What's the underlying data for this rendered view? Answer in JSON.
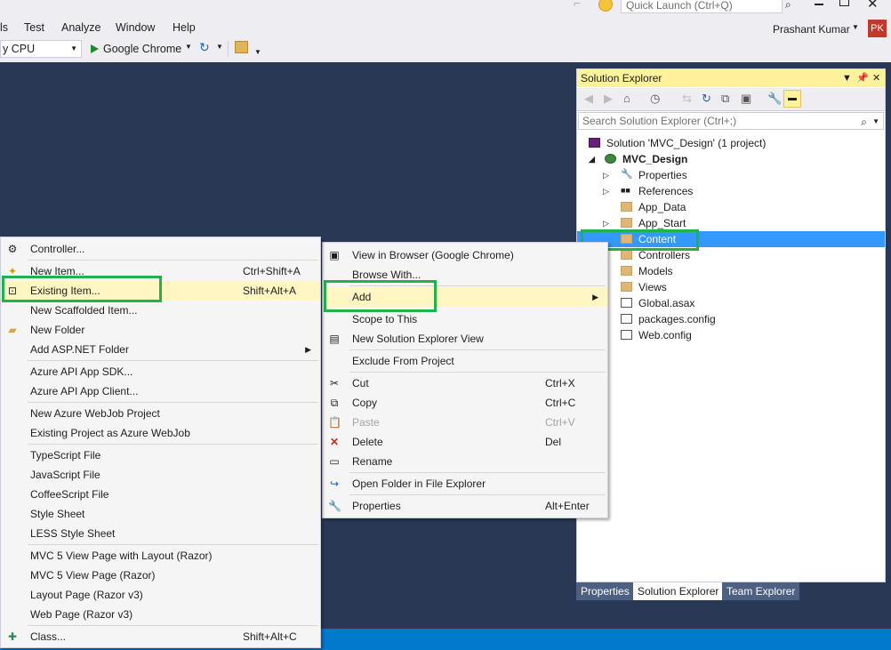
{
  "menubar": {
    "items": [
      "ls",
      "Test",
      "Analyze",
      "Window",
      "Help"
    ]
  },
  "quick_launch": {
    "placeholder": "Quick Launch (Ctrl+Q)"
  },
  "user": {
    "name": "Prashant Kumar",
    "initials": "PK"
  },
  "toolbar": {
    "platform": "y CPU",
    "run_target": "Google Chrome"
  },
  "add_menu": {
    "items": [
      {
        "label": "Controller...",
        "shortcut": ""
      },
      {
        "label": "New Item...",
        "shortcut": "Ctrl+Shift+A"
      },
      {
        "label": "Existing Item...",
        "shortcut": "Shift+Alt+A"
      },
      {
        "label": "New Scaffolded Item...",
        "shortcut": ""
      },
      {
        "label": "New Folder",
        "shortcut": ""
      },
      {
        "label": "Add ASP.NET Folder",
        "shortcut": ""
      },
      {
        "label": "Azure API App SDK...",
        "shortcut": ""
      },
      {
        "label": "Azure API App Client...",
        "shortcut": ""
      },
      {
        "label": "New Azure WebJob Project",
        "shortcut": ""
      },
      {
        "label": "Existing Project as Azure WebJob",
        "shortcut": ""
      },
      {
        "label": "TypeScript File",
        "shortcut": ""
      },
      {
        "label": "JavaScript File",
        "shortcut": ""
      },
      {
        "label": "CoffeeScript File",
        "shortcut": ""
      },
      {
        "label": "Style Sheet",
        "shortcut": ""
      },
      {
        "label": "LESS Style Sheet",
        "shortcut": ""
      },
      {
        "label": "MVC 5 View Page with Layout (Razor)",
        "shortcut": ""
      },
      {
        "label": "MVC 5 View Page (Razor)",
        "shortcut": ""
      },
      {
        "label": "Layout Page (Razor v3)",
        "shortcut": ""
      },
      {
        "label": "Web Page (Razor v3)",
        "shortcut": ""
      },
      {
        "label": "Class...",
        "shortcut": "Shift+Alt+C"
      }
    ]
  },
  "project_menu": {
    "items": [
      {
        "label": "View in Browser (Google Chrome)",
        "shortcut": ""
      },
      {
        "label": "Browse With...",
        "shortcut": ""
      },
      {
        "label": "Add",
        "shortcut": ""
      },
      {
        "label": "Scope to This",
        "shortcut": ""
      },
      {
        "label": "New Solution Explorer View",
        "shortcut": ""
      },
      {
        "label": "Exclude From Project",
        "shortcut": ""
      },
      {
        "label": "Cut",
        "shortcut": "Ctrl+X"
      },
      {
        "label": "Copy",
        "shortcut": "Ctrl+C"
      },
      {
        "label": "Paste",
        "shortcut": "Ctrl+V"
      },
      {
        "label": "Delete",
        "shortcut": "Del"
      },
      {
        "label": "Rename",
        "shortcut": ""
      },
      {
        "label": "Open Folder in File Explorer",
        "shortcut": ""
      },
      {
        "label": "Properties",
        "shortcut": "Alt+Enter"
      }
    ]
  },
  "solution_explorer": {
    "title": "Solution Explorer",
    "search_placeholder": "Search Solution Explorer (Ctrl+;)",
    "tree": [
      "Solution 'MVC_Design' (1 project)",
      "MVC_Design",
      "Properties",
      "References",
      "App_Data",
      "App_Start",
      "Content",
      "Controllers",
      "Models",
      "Views",
      "Global.asax",
      "packages.config",
      "Web.config"
    ],
    "tabs": [
      "Properties",
      "Solution Explorer",
      "Team Explorer"
    ]
  }
}
